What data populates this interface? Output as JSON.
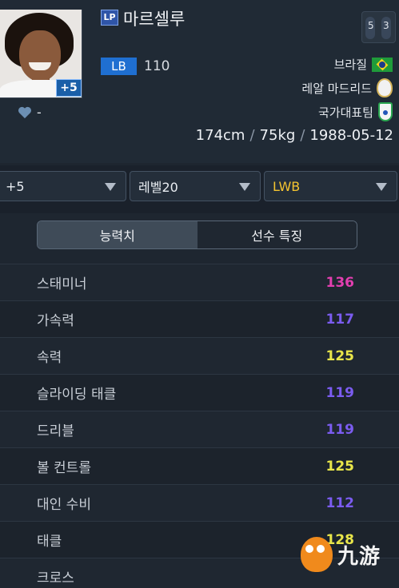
{
  "player": {
    "name": "마르셀루",
    "season_badge": "LP",
    "position": "LB",
    "overall": "110",
    "enhance_badge": "+5",
    "likes": "-",
    "nation": "브라질",
    "club": "레알 마드리드",
    "national_team": "국가대표팀",
    "height": "174cm",
    "weight": "75kg",
    "birthdate": "1988-05-12",
    "weak_foot_left": "5",
    "weak_foot_right": "3"
  },
  "dropdowns": {
    "enhance": "+5",
    "level": "레벨20",
    "position": "LWB"
  },
  "tabs": {
    "ability": "능력치",
    "traits": "선수 특징"
  },
  "stats": [
    {
      "label": "스태미너",
      "value": "136",
      "color": "#e23fb0"
    },
    {
      "label": "가속력",
      "value": "117",
      "color": "#7b5cf0"
    },
    {
      "label": "속력",
      "value": "125",
      "color": "#e9e64a"
    },
    {
      "label": "슬라이딩 태클",
      "value": "119",
      "color": "#7b5cf0"
    },
    {
      "label": "드리블",
      "value": "119",
      "color": "#7b5cf0"
    },
    {
      "label": "볼 컨트롤",
      "value": "125",
      "color": "#e9e64a"
    },
    {
      "label": "대인 수비",
      "value": "112",
      "color": "#7b5cf0"
    },
    {
      "label": "태클",
      "value": "128",
      "color": "#e9e64a"
    },
    {
      "label": "크로스",
      "value": "",
      "color": "#7b5cf0"
    }
  ],
  "watermark": {
    "text": "九游"
  },
  "icons": {
    "heart": "heart-icon",
    "dropdown": "chevron-down-icon",
    "flag": "brazil-flag-icon",
    "club": "real-madrid-crest-icon",
    "national": "cbf-crest-icon"
  }
}
